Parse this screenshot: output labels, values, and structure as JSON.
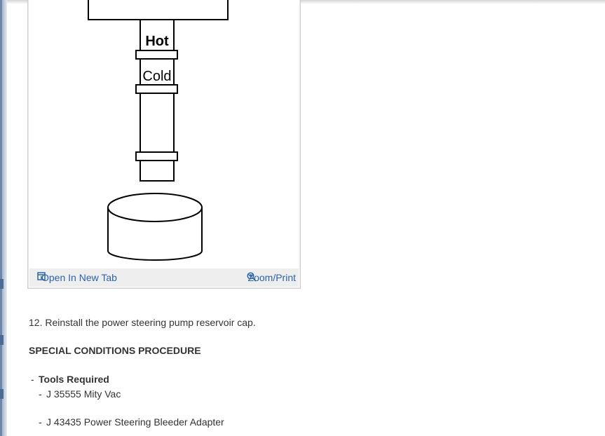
{
  "figure": {
    "labels": {
      "hot": "Hot",
      "cold": "Cold"
    },
    "open_label": "Open In New Tab",
    "zoom_label": "Zoom/Print"
  },
  "content": {
    "step": "12. Reinstall the power steering pump reservoir cap.",
    "heading": "SPECIAL CONDITIONS PROCEDURE",
    "tools_bullet": "-",
    "tools_title": "Tools Required",
    "tools": [
      {
        "bullet": "-",
        "text": "J 35555 Mity Vac"
      },
      {
        "bullet": "-",
        "text": "J 43435 Power Steering Bleeder Adapter"
      }
    ]
  },
  "colors": {
    "link": "#2a63a8",
    "toolbar_bg": "#eeeeee",
    "text": "#333333"
  }
}
